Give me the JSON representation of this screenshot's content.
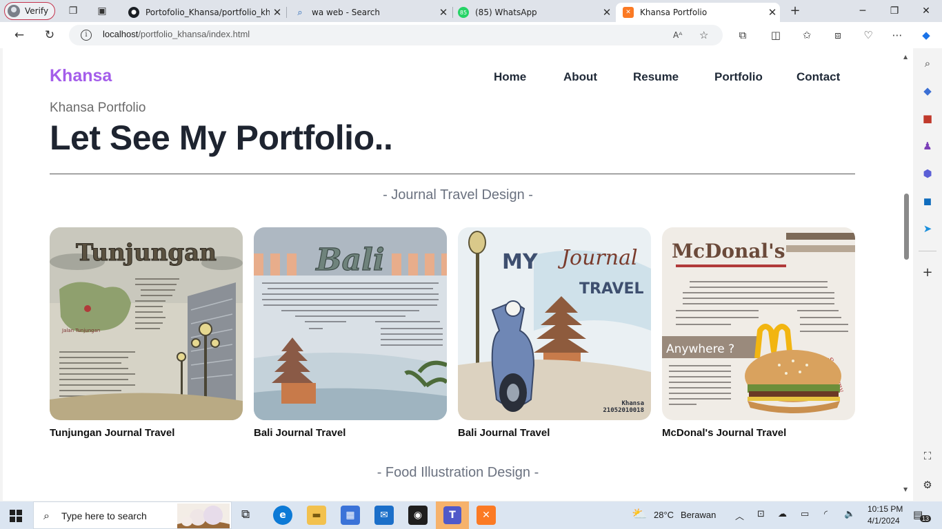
{
  "browser": {
    "profile_label": "Verify",
    "tabs": [
      {
        "title": "Portofolio_Khansa/portfolio_khansa",
        "icon": "github-icon"
      },
      {
        "title": "wa web - Search",
        "icon": "search-icon"
      },
      {
        "title": "(85) WhatsApp",
        "icon": "whatsapp-icon",
        "badge": "85"
      },
      {
        "title": "Khansa Portfolio",
        "icon": "xampp-icon",
        "active": true
      }
    ],
    "url_host": "localhost",
    "url_path": "/portfolio_khansa/index.html"
  },
  "site": {
    "brand": "Khansa",
    "nav": [
      "Home",
      "About",
      "Resume",
      "Portfolio",
      "Contact"
    ],
    "subtitle": "Khansa Portfolio",
    "heading": "Let See My Portfolio..",
    "section_journal": "- Journal Travel Design -",
    "section_food": "- Food Illustration Design -",
    "cards": [
      {
        "caption": "Tunjungan Journal Travel",
        "art_title": "Tunjungan",
        "art_note": "Jalan Tunjungan"
      },
      {
        "caption": "Bali Journal Travel",
        "art_title": "Bali"
      },
      {
        "caption": "Bali Journal Travel",
        "art_title_a": "MY",
        "art_title_b": "Journal",
        "art_title_c": "TRAVEL",
        "art_sig_a": "Khansa",
        "art_sig_b": "21052010018"
      },
      {
        "caption": "McDonal's Journal Travel",
        "art_title": "McDonal's",
        "art_sub": "Anywhere ?",
        "art_sig": "So Yummy"
      }
    ]
  },
  "taskbar": {
    "search_placeholder": "Type here to search",
    "weather_temp": "28°C",
    "weather_text": "Berawan",
    "time": "10:15 PM",
    "date": "4/1/2024",
    "notif_count": "13"
  },
  "colors": {
    "brand": "#a45dea",
    "heading": "#1e2430",
    "section": "#6b7280",
    "tab_strip": "#dfe3ea",
    "taskbar": "#dbe5f1"
  }
}
